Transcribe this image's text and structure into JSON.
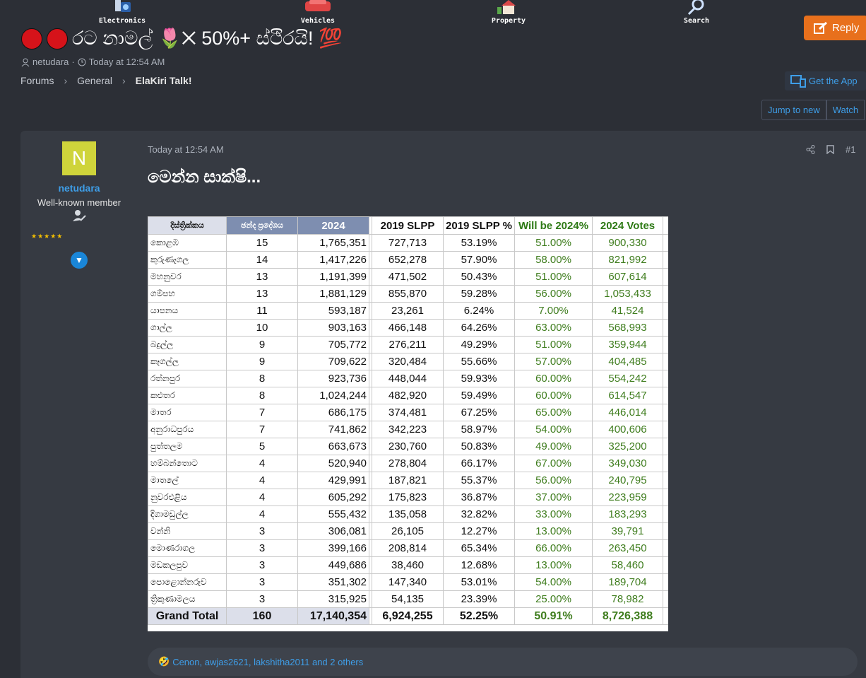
{
  "nav": {
    "items": [
      {
        "label": "Electronics",
        "icon": "electronics-icon"
      },
      {
        "label": "Vehicles",
        "icon": "car-icon"
      },
      {
        "label": "Property",
        "icon": "house-icon"
      },
      {
        "label": "Search",
        "icon": "magnifier-icon"
      }
    ]
  },
  "reply_label": "Reply",
  "thread": {
    "title_text": "රට නාමල් 🌷✕ 50%+ ස්ථිරයි! 💯",
    "author": "netudara",
    "time": "Today at 12:54 AM"
  },
  "breadcrumb": [
    "Forums",
    "General",
    "ElaKiri Talk!"
  ],
  "get_app_label": "Get the App",
  "jump_label": "Jump to new",
  "watch_label": "Watch",
  "user": {
    "initial": "N",
    "name": "netudara",
    "title": "Well-known member",
    "stars": "★★★★★"
  },
  "post": {
    "time": "Today at 12:54 AM",
    "number": "#1",
    "heading": "මෙන්න සාක්ෂි..."
  },
  "table": {
    "headers": {
      "district": "දිස්ත්‍රික්කය",
      "seats": "ඡන්ද ප්‍රදේශය",
      "year2024": "2024",
      "slpp2019": "2019 SLPP",
      "slpp_pct": "2019 SLPP %",
      "will2024": "Will be 2024%",
      "votes2024": "2024 Votes"
    },
    "rows": [
      [
        "කොළඹ",
        "15",
        "1,765,351",
        "727,713",
        "53.19%",
        "51.00%",
        "900,330"
      ],
      [
        "කුරුණෑගල",
        "14",
        "1,417,226",
        "652,278",
        "57.90%",
        "58.00%",
        "821,992"
      ],
      [
        "මහනුවර",
        "13",
        "1,191,399",
        "471,502",
        "50.43%",
        "51.00%",
        "607,614"
      ],
      [
        "ගම්පහ",
        "13",
        "1,881,129",
        "855,870",
        "59.28%",
        "56.00%",
        "1,053,433"
      ],
      [
        "යාපනය",
        "11",
        "593,187",
        "23,261",
        "6.24%",
        "7.00%",
        "41,524"
      ],
      [
        "ගාල්ල",
        "10",
        "903,163",
        "466,148",
        "64.26%",
        "63.00%",
        "568,993"
      ],
      [
        "බදුල්ල",
        "9",
        "705,772",
        "276,211",
        "49.29%",
        "51.00%",
        "359,944"
      ],
      [
        "කෑගල්ල",
        "9",
        "709,622",
        "320,484",
        "55.66%",
        "57.00%",
        "404,485"
      ],
      [
        "රත්නපුර",
        "8",
        "923,736",
        "448,044",
        "59.93%",
        "60.00%",
        "554,242"
      ],
      [
        "කළුතර",
        "8",
        "1,024,244",
        "482,920",
        "59.49%",
        "60.00%",
        "614,547"
      ],
      [
        "මාතර",
        "7",
        "686,175",
        "374,481",
        "67.25%",
        "65.00%",
        "446,014"
      ],
      [
        "අනුරාධපුරය",
        "7",
        "741,862",
        "342,223",
        "58.97%",
        "54.00%",
        "400,606"
      ],
      [
        "පුත්තලම",
        "5",
        "663,673",
        "230,760",
        "50.83%",
        "49.00%",
        "325,200"
      ],
      [
        "හම්බන්තොට",
        "4",
        "520,940",
        "278,804",
        "66.17%",
        "67.00%",
        "349,030"
      ],
      [
        "මාතලේ",
        "4",
        "429,991",
        "187,821",
        "55.37%",
        "56.00%",
        "240,795"
      ],
      [
        "නුවරඑළිය",
        "4",
        "605,292",
        "175,823",
        "36.87%",
        "37.00%",
        "223,959"
      ],
      [
        "දිගාමඩුල්ල",
        "4",
        "555,432",
        "135,058",
        "32.82%",
        "33.00%",
        "183,293"
      ],
      [
        "වන්නි",
        "3",
        "306,081",
        "26,105",
        "12.27%",
        "13.00%",
        "39,791"
      ],
      [
        "මොණරාගල",
        "3",
        "399,166",
        "208,814",
        "65.34%",
        "66.00%",
        "263,450"
      ],
      [
        "මඩකලපුව",
        "3",
        "449,686",
        "38,460",
        "12.68%",
        "13.00%",
        "58,460"
      ],
      [
        "පොළොන්නරුව",
        "3",
        "351,302",
        "147,340",
        "53.01%",
        "54.00%",
        "189,704"
      ],
      [
        "ත්‍රිකුණාමලය",
        "3",
        "315,925",
        "54,135",
        "23.39%",
        "25.00%",
        "78,982"
      ]
    ],
    "total": [
      "Grand Total",
      "160",
      "17,140,354",
      "6,924,255",
      "52.25%",
      "50.91%",
      "8,726,388"
    ]
  },
  "reactions": {
    "emoji": "🤣",
    "text": "Cenon, awjas2621, lakshitha2011 and 2 others"
  },
  "colors": {
    "accent": "#3e9ee8",
    "reply": "#e8701c",
    "green": "#3f7d1e"
  }
}
